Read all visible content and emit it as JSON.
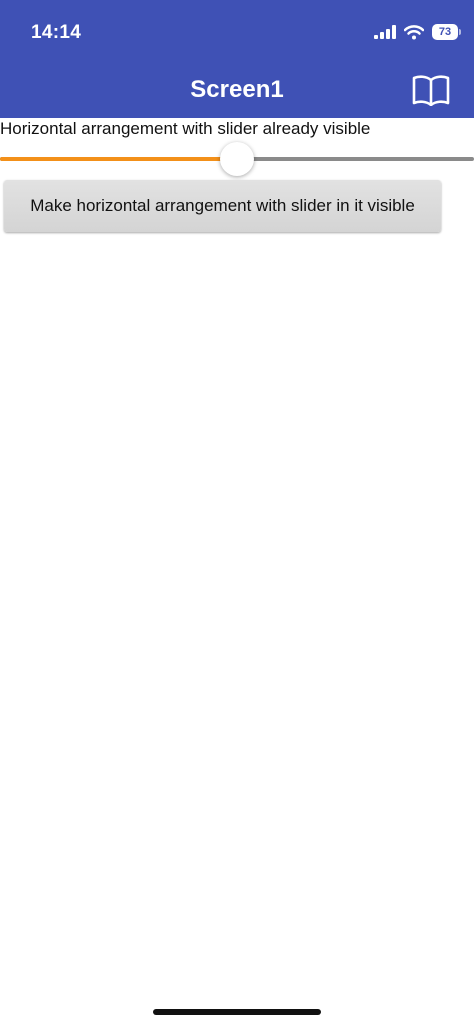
{
  "status_bar": {
    "time": "14:14",
    "battery_level": "73",
    "icons": [
      "signal-icon",
      "wifi-icon",
      "battery-icon"
    ]
  },
  "header": {
    "title": "Screen1",
    "icon": "book-icon",
    "background_color": "#3f51b5"
  },
  "arrangement": {
    "label": "Horizontal arrangement with slider already visible",
    "slider": {
      "value_fraction": 0.5,
      "fill_color": "#f39019",
      "track_color": "#8a8a8a"
    }
  },
  "button": {
    "label": "Make horizontal arrangement with slider in it visible"
  }
}
